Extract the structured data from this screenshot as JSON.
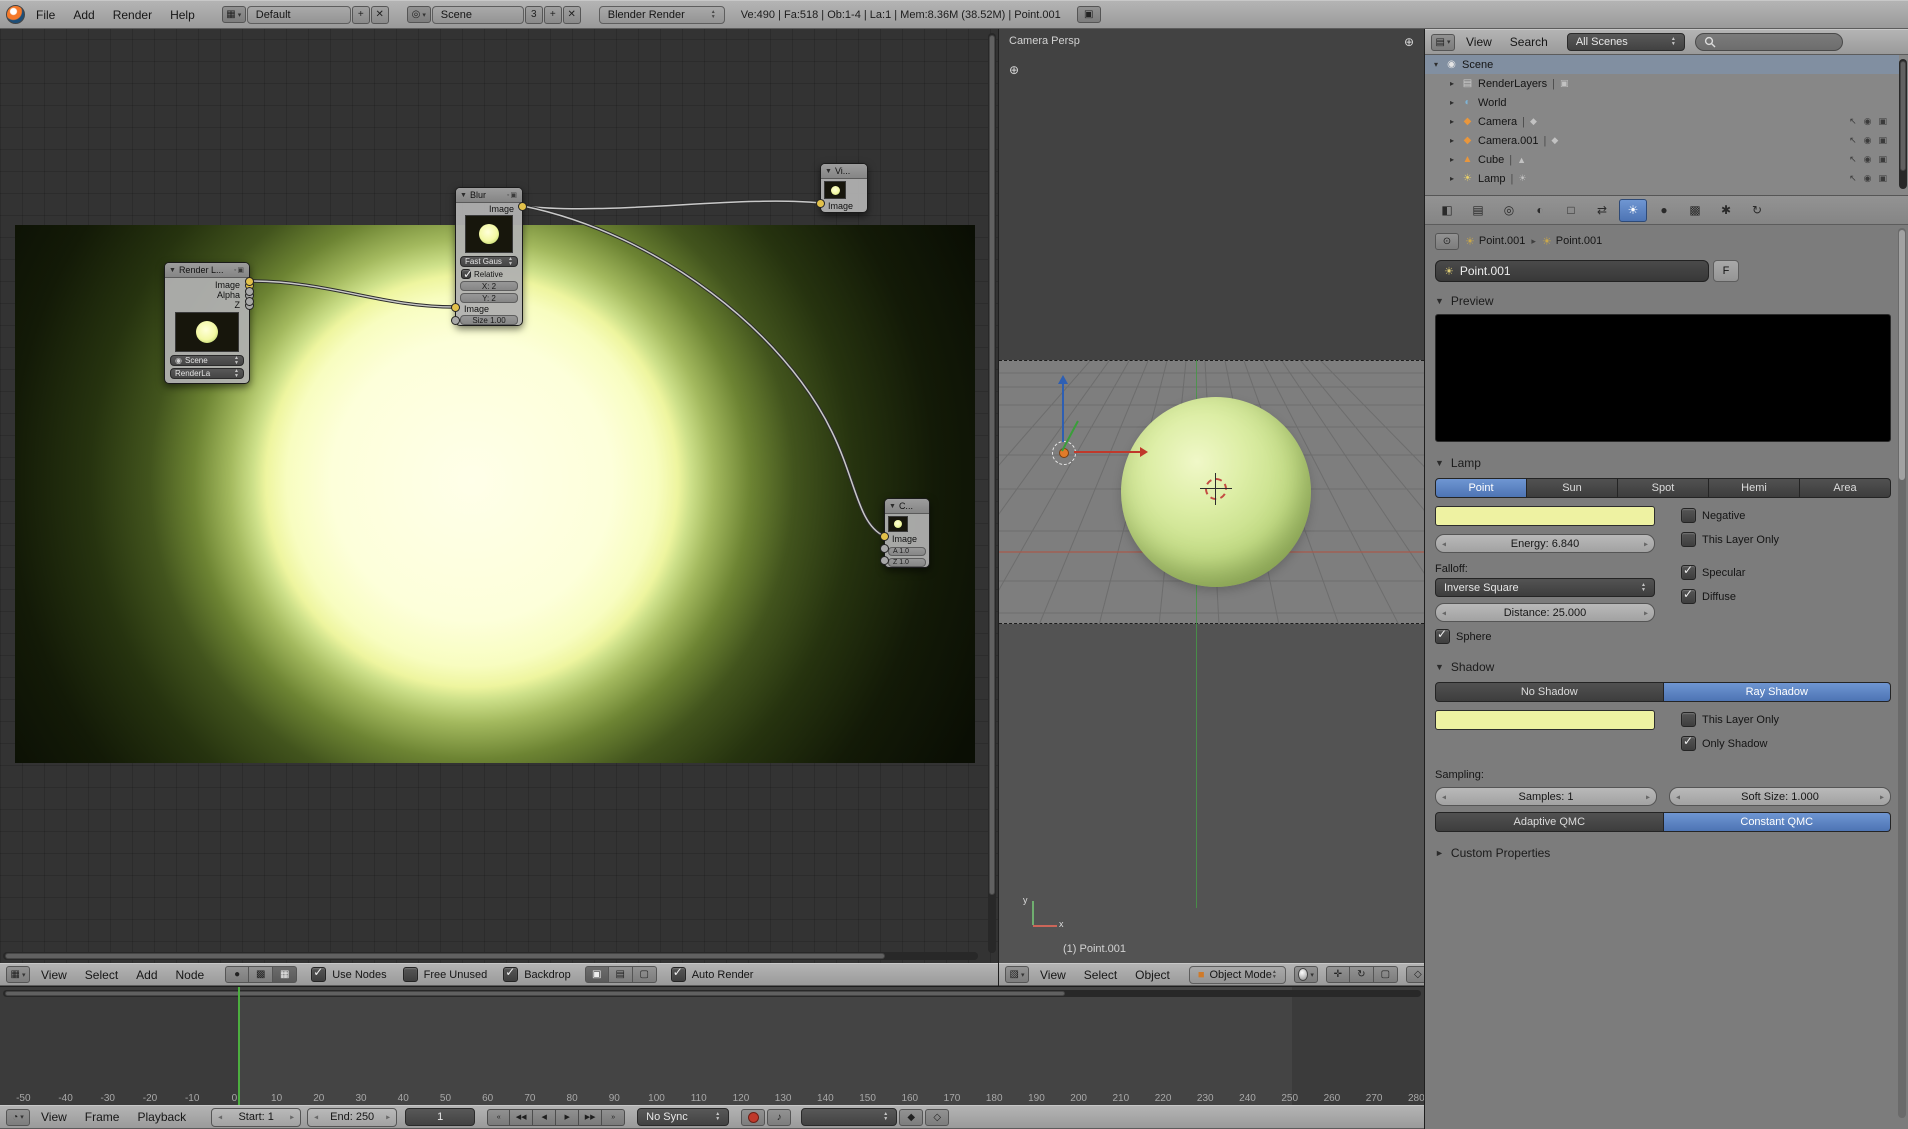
{
  "colors": {
    "accent": "#4d74b4",
    "lamp_color": "#eef2a2",
    "frame_green": "#4cae3f"
  },
  "topbar": {
    "menus": [
      "File",
      "Add",
      "Render",
      "Help"
    ],
    "layout_value": "Default",
    "scene_value": "Scene",
    "scene_users": "3",
    "engine_value": "Blender Render",
    "stats": "Ve:490 | Fa:518 | Ob:1-4 | La:1 | Mem:8.36M (38.52M) | Point.001"
  },
  "node_editor": {
    "header": {
      "menus": [
        "View",
        "Select",
        "Add",
        "Node"
      ],
      "toggles": [
        {
          "label": "Use Nodes",
          "checked": true
        },
        {
          "label": "Free Unused",
          "checked": false
        },
        {
          "label": "Backdrop",
          "checked": true
        },
        {
          "label": "Auto Render",
          "checked": true
        }
      ]
    },
    "render_layers_node": {
      "title": "Render L...",
      "outputs": [
        "Image",
        "Alpha",
        "Z"
      ],
      "scene_field": "Scene",
      "layer_field": "RenderLa"
    },
    "blur_node": {
      "title": "Blur",
      "output_label": "Image",
      "filter_type": "Fast Gaus",
      "relative_label": "Relative",
      "relative_checked": true,
      "x_value": "X: 2",
      "y_value": "Y: 2",
      "input_label": "Image",
      "size_value": "Size 1.00"
    },
    "viewer_node": {
      "title": "Vi...",
      "input_label": "Image"
    },
    "composite_node": {
      "title": "C...",
      "input_label": "Image",
      "alpha_value": "A 1.0",
      "z_value": "Z 1.0"
    }
  },
  "viewport": {
    "view_label": "Camera Persp",
    "active_object": "(1) Point.001",
    "header": {
      "menus": [
        "View",
        "Select",
        "Object"
      ],
      "mode_value": "Object Mode"
    }
  },
  "timeline": {
    "ruler": {
      "start": -50,
      "end": 280,
      "step": 10
    },
    "current_frame": 1,
    "header": {
      "menus": [
        "View",
        "Frame",
        "Playback"
      ],
      "start_value": "Start: 1",
      "end_value": "End: 250",
      "frame_value": "1",
      "sync_value": "No Sync",
      "transport": [
        {
          "name": "jump-to-start-button",
          "glyph": "«"
        },
        {
          "name": "rewind-button",
          "glyph": "◀◀"
        },
        {
          "name": "play-reverse-button",
          "glyph": "◀"
        },
        {
          "name": "play-button",
          "glyph": "▶"
        },
        {
          "name": "fast-forward-button",
          "glyph": "▶▶"
        },
        {
          "name": "jump-to-end-button",
          "glyph": "»"
        }
      ]
    }
  },
  "outliner": {
    "header": {
      "menus": [
        "View",
        "Search"
      ],
      "filter_value": "All Scenes"
    },
    "rows": [
      {
        "label": "Scene",
        "icon": "scene-icon",
        "glyph": "◉",
        "expander": "▾",
        "selected": true,
        "indent": 0,
        "pipe": false,
        "restrict": false
      },
      {
        "label": "RenderLayers",
        "icon": "renderlayers-icon",
        "glyph": "▤",
        "expander": "▸",
        "selected": false,
        "indent": 1,
        "pipe": true,
        "data_glyph": "▣",
        "restrict": false
      },
      {
        "label": "World",
        "icon": "world-icon",
        "glyph": "◐",
        "expander": "▸",
        "selected": false,
        "indent": 1,
        "pipe": false,
        "restrict": false
      },
      {
        "label": "Camera",
        "icon": "camera-icon",
        "glyph": "◆",
        "expander": "▸",
        "selected": false,
        "indent": 1,
        "pipe": true,
        "data_glyph": "◆",
        "restrict": true
      },
      {
        "label": "Camera.001",
        "icon": "camera-icon",
        "glyph": "◆",
        "expander": "▸",
        "selected": false,
        "indent": 1,
        "pipe": true,
        "data_glyph": "◆",
        "restrict": true
      },
      {
        "label": "Cube",
        "icon": "mesh-icon",
        "glyph": "▲",
        "expander": "▸",
        "selected": false,
        "indent": 1,
        "pipe": true,
        "data_glyph": "▲",
        "restrict": true
      },
      {
        "label": "Lamp",
        "icon": "lamp-icon",
        "glyph": "☀",
        "expander": "▸",
        "selected": false,
        "indent": 1,
        "pipe": true,
        "data_glyph": "☀",
        "restrict": true
      }
    ]
  },
  "properties": {
    "tabs": [
      {
        "name": "render-tab-icon",
        "glyph": "◧",
        "active": false
      },
      {
        "name": "render-layers-tab-icon",
        "glyph": "▤",
        "active": false
      },
      {
        "name": "scene-tab-icon",
        "glyph": "◎",
        "active": false
      },
      {
        "name": "world-tab-icon",
        "glyph": "◐",
        "active": false
      },
      {
        "name": "object-tab-icon",
        "glyph": "□",
        "active": false
      },
      {
        "name": "constraints-tab-icon",
        "glyph": "⇄",
        "active": false
      },
      {
        "name": "object-data-tab-icon",
        "glyph": "☀",
        "active": true
      },
      {
        "name": "material-tab-icon",
        "glyph": "●",
        "active": false
      },
      {
        "name": "texture-tab-icon",
        "glyph": "▩",
        "active": false
      },
      {
        "name": "particles-tab-icon",
        "glyph": "✱",
        "active": false
      },
      {
        "name": "physics-tab-icon",
        "glyph": "↻",
        "active": false
      }
    ],
    "breadcrumb": [
      {
        "label": "Point.001"
      },
      {
        "label": "Point.001"
      }
    ],
    "name_value": "Point.001",
    "fake_user_label": "F",
    "preview_title": "Preview",
    "lamp": {
      "title": "Lamp",
      "types": [
        "Point",
        "Sun",
        "Spot",
        "Hemi",
        "Area"
      ],
      "active_type": 0,
      "energy": "Energy: 6.840",
      "negative_label": "Negative",
      "negative_checked": false,
      "layer_label": "This Layer Only",
      "layer_checked": false,
      "falloff_label": "Falloff:",
      "falloff_value": "Inverse Square",
      "specular_label": "Specular",
      "specular_checked": true,
      "diffuse_label": "Diffuse",
      "diffuse_checked": true,
      "distance": "Distance: 25.000",
      "sphere_label": "Sphere",
      "sphere_checked": true
    },
    "shadow": {
      "title": "Shadow",
      "modes": [
        "No Shadow",
        "Ray Shadow"
      ],
      "active_mode": 1,
      "layer_label": "This Layer Only",
      "layer_checked": false,
      "only_label": "Only Shadow",
      "only_checked": true,
      "sampling_label": "Sampling:",
      "samples": "Samples: 1",
      "soft_size": "Soft Size: 1.000",
      "qmc": [
        "Adaptive QMC",
        "Constant QMC"
      ],
      "active_qmc": 1
    },
    "custom_title": "Custom Properties"
  }
}
